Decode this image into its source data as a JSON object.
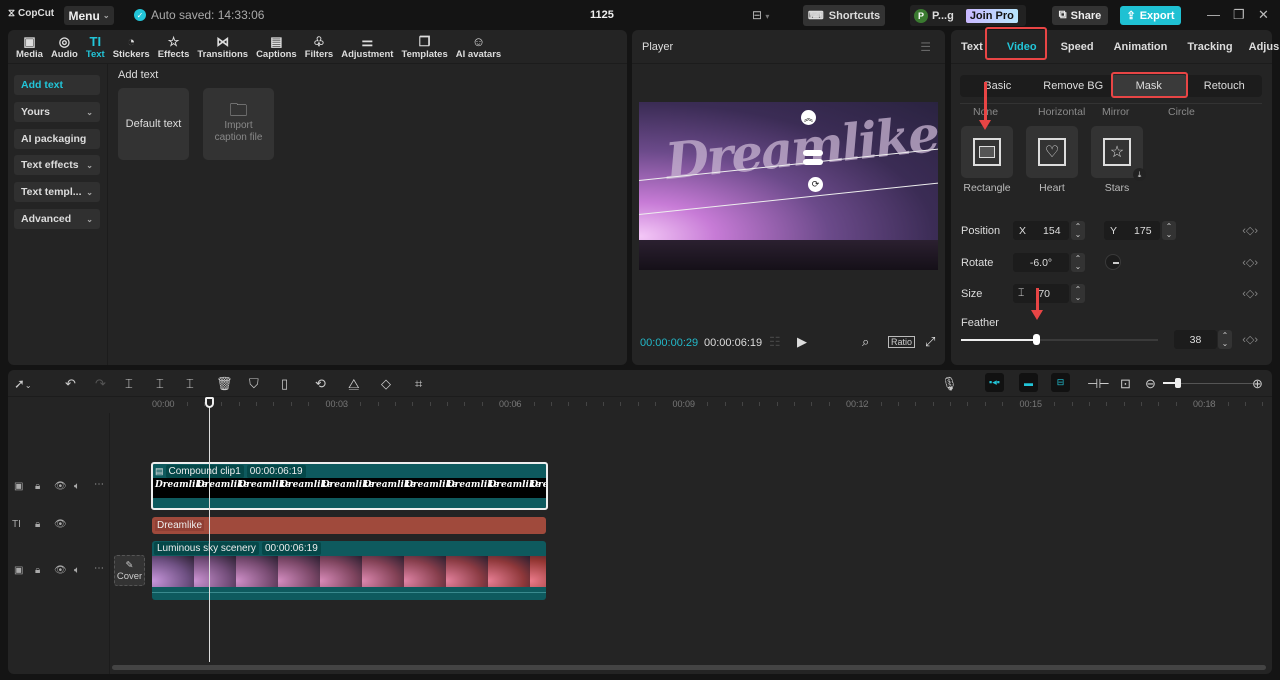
{
  "titlebar": {
    "app_name": "CopCut",
    "menu_label": "Menu",
    "autosave_text": "Auto saved: 14:33:06",
    "project_title": "1125",
    "shortcuts_label": "Shortcuts",
    "user_initial": "P",
    "user_name": "P...g",
    "join_pro_label": "Join Pro",
    "share_label": "Share",
    "export_label": "Export"
  },
  "media_toolbar": {
    "tools": [
      {
        "label": "Media",
        "icon": "▣"
      },
      {
        "label": "Audio",
        "icon": "◎"
      },
      {
        "label": "Text",
        "icon": "TI"
      },
      {
        "label": "Stickers",
        "icon": "◔"
      },
      {
        "label": "Effects",
        "icon": "☆"
      },
      {
        "label": "Transitions",
        "icon": "⋈"
      },
      {
        "label": "Captions",
        "icon": "▤"
      },
      {
        "label": "Filters",
        "icon": "♧"
      },
      {
        "label": "Adjustment",
        "icon": "⚌"
      },
      {
        "label": "Templates",
        "icon": "❐"
      },
      {
        "label": "AI avatars",
        "icon": "☺"
      }
    ],
    "active": "Text"
  },
  "text_nav": {
    "items": [
      {
        "label": "Add text",
        "has_chevron": false
      },
      {
        "label": "Yours",
        "has_chevron": true
      },
      {
        "label": "AI packaging",
        "has_chevron": false
      },
      {
        "label": "Text effects",
        "has_chevron": true
      },
      {
        "label": "Text templ...",
        "has_chevron": true
      },
      {
        "label": "Advanced",
        "has_chevron": true
      }
    ]
  },
  "add_text": {
    "section_title": "Add text",
    "default_text_label": "Default text",
    "import_caption_label_1": "Import",
    "import_caption_label_2": "caption file"
  },
  "player": {
    "title": "Player",
    "overlay_text": "Dreamlike",
    "current_time": "00:00:00:29",
    "total_time": "00:00:06:19",
    "ratio_label": "Ratio"
  },
  "properties": {
    "tabs": [
      "Text",
      "Video",
      "Speed",
      "Animation",
      "Tracking",
      "Adjus"
    ],
    "active_tab": "Video",
    "subtabs": [
      "Basic",
      "Remove BG",
      "Mask",
      "Retouch"
    ],
    "active_subtab": "Mask",
    "mask_row1": [
      "None",
      "Horizontal",
      "Mirror",
      "Circle"
    ],
    "mask_row2": [
      "Rectangle",
      "Heart",
      "Stars"
    ],
    "position_label": "Position",
    "position_x_label": "X",
    "position_x": "154",
    "position_y_label": "Y",
    "position_y": "175",
    "rotate_label": "Rotate",
    "rotate_value": "-6.0°",
    "size_label": "Size",
    "size_value": "70",
    "feather_label": "Feather",
    "feather_value": "38",
    "feather_percent": 38
  },
  "timeline": {
    "ruler_labels": [
      "00:00",
      "00:03",
      "00:06",
      "00:09",
      "00:12",
      "00:15",
      "00:18"
    ],
    "cover_label": "Cover",
    "clips": {
      "compound": {
        "name": "Compound clip1",
        "duration": "00:00:06:19",
        "thumb_text": "Dreamlike"
      },
      "text": {
        "name": "Dreamlike"
      },
      "video": {
        "name": "Luminous sky scenery",
        "duration": "00:00:06:19"
      }
    }
  },
  "colors": {
    "accent": "#22c5d8",
    "highlight_red": "#e84545",
    "text_clip": "#a04a3c",
    "video_clip": "#0e5a5e"
  }
}
